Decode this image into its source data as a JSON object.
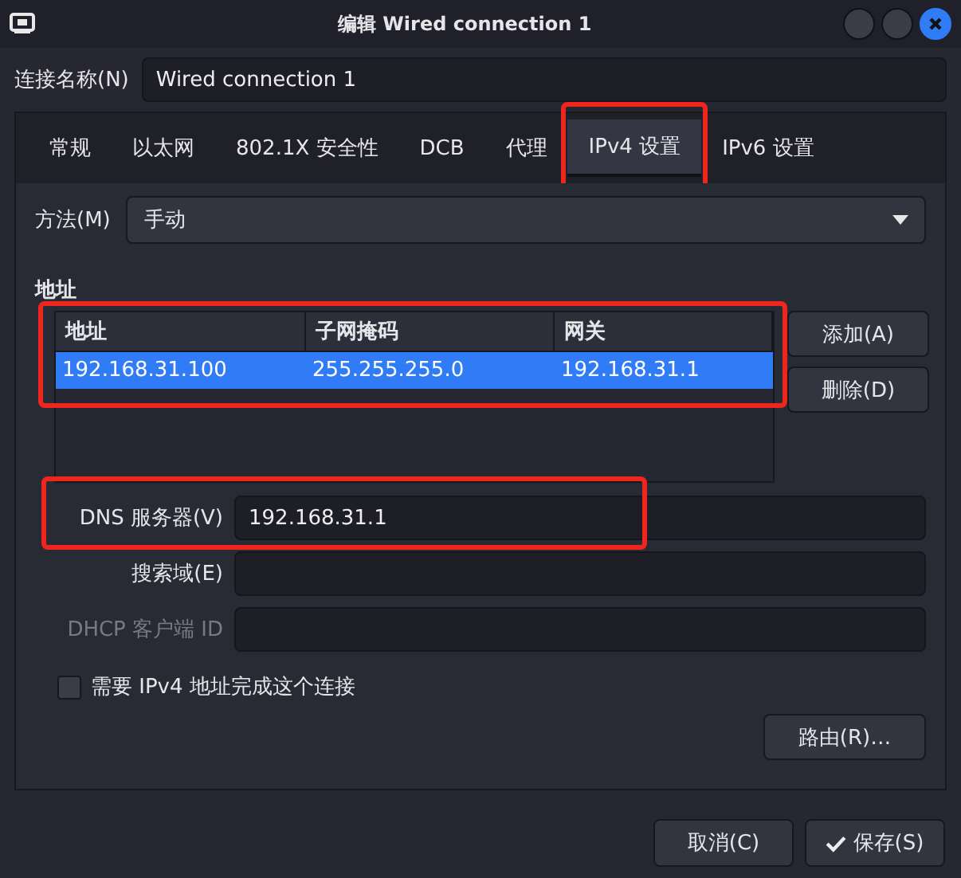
{
  "window": {
    "title": "编辑 Wired connection 1"
  },
  "connection_name": {
    "label": "连接名称(N)",
    "value": "Wired connection 1"
  },
  "tabs": [
    {
      "label": "常规",
      "selected": false,
      "highlighted": false
    },
    {
      "label": "以太网",
      "selected": false,
      "highlighted": false
    },
    {
      "label": "802.1X 安全性",
      "selected": false,
      "highlighted": false
    },
    {
      "label": "DCB",
      "selected": false,
      "highlighted": false
    },
    {
      "label": "代理",
      "selected": false,
      "highlighted": false
    },
    {
      "label": "IPv4 设置",
      "selected": true,
      "highlighted": true
    },
    {
      "label": "IPv6 设置",
      "selected": false,
      "highlighted": false
    }
  ],
  "method": {
    "label": "方法(M)",
    "value": "手动"
  },
  "addresses": {
    "heading": "地址",
    "highlighted": true,
    "columns": [
      "地址",
      "子网掩码",
      "网关"
    ],
    "rows": [
      {
        "cells": [
          "192.168.31.100",
          "255.255.255.0",
          "192.168.31.1"
        ],
        "selected": true
      }
    ],
    "buttons": [
      "添加(A)",
      "删除(D)"
    ]
  },
  "fields": [
    {
      "label": "DNS 服务器(V)",
      "value": "192.168.31.1",
      "highlighted": true,
      "disabled": false
    },
    {
      "label": "搜索域(E)",
      "highlighted": false,
      "disabled": false
    },
    {
      "label": "DHCP 客户端 ID",
      "highlighted": false,
      "disabled": true
    }
  ],
  "require_ipv4": {
    "label": "需要 IPv4 地址完成这个连接",
    "checked": false
  },
  "routes_button": "路由(R)…",
  "buttons": [
    {
      "label": "取消(C)",
      "kind": "cancel"
    },
    {
      "label": "保存(S)",
      "kind": "save"
    }
  ]
}
